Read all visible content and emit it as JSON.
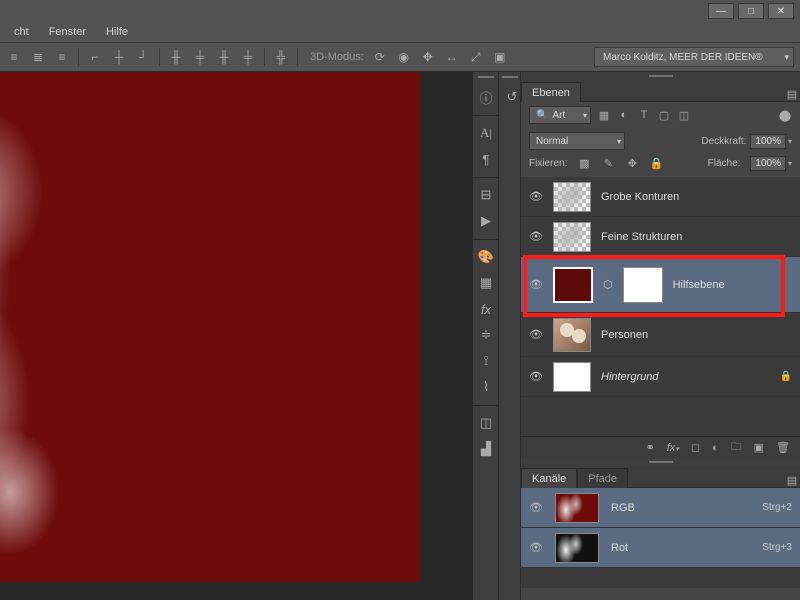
{
  "title_bar": {
    "minimize": "—",
    "maximize": "□",
    "close": "✕"
  },
  "menu": {
    "items": [
      "cht",
      "Fenster",
      "Hilfe"
    ]
  },
  "toolbar": {
    "mode_label": "3D-Modus:"
  },
  "workspace": {
    "selected": "Marco Kolditz, MEER DER IDEEN®"
  },
  "layers_panel": {
    "tab": "Ebenen",
    "search": {
      "placeholder": "Art"
    },
    "blend_mode": "Normal",
    "opacity_label": "Deckkraft:",
    "opacity_value": "100%",
    "fill_label": "Fläche:",
    "fill_value": "100%",
    "lock_label": "Fixieren:",
    "layers": [
      {
        "name": "Grobe Konturen"
      },
      {
        "name": "Feine Strukturen"
      },
      {
        "name": "Hilfsebene"
      },
      {
        "name": "Personen"
      },
      {
        "name": "Hintergrund"
      }
    ]
  },
  "channels_panel": {
    "tabs": [
      "Kanäle",
      "Pfade"
    ],
    "channels": [
      {
        "name": "RGB",
        "shortcut": "Strg+2"
      },
      {
        "name": "Rot",
        "shortcut": "Strg+3"
      }
    ]
  }
}
